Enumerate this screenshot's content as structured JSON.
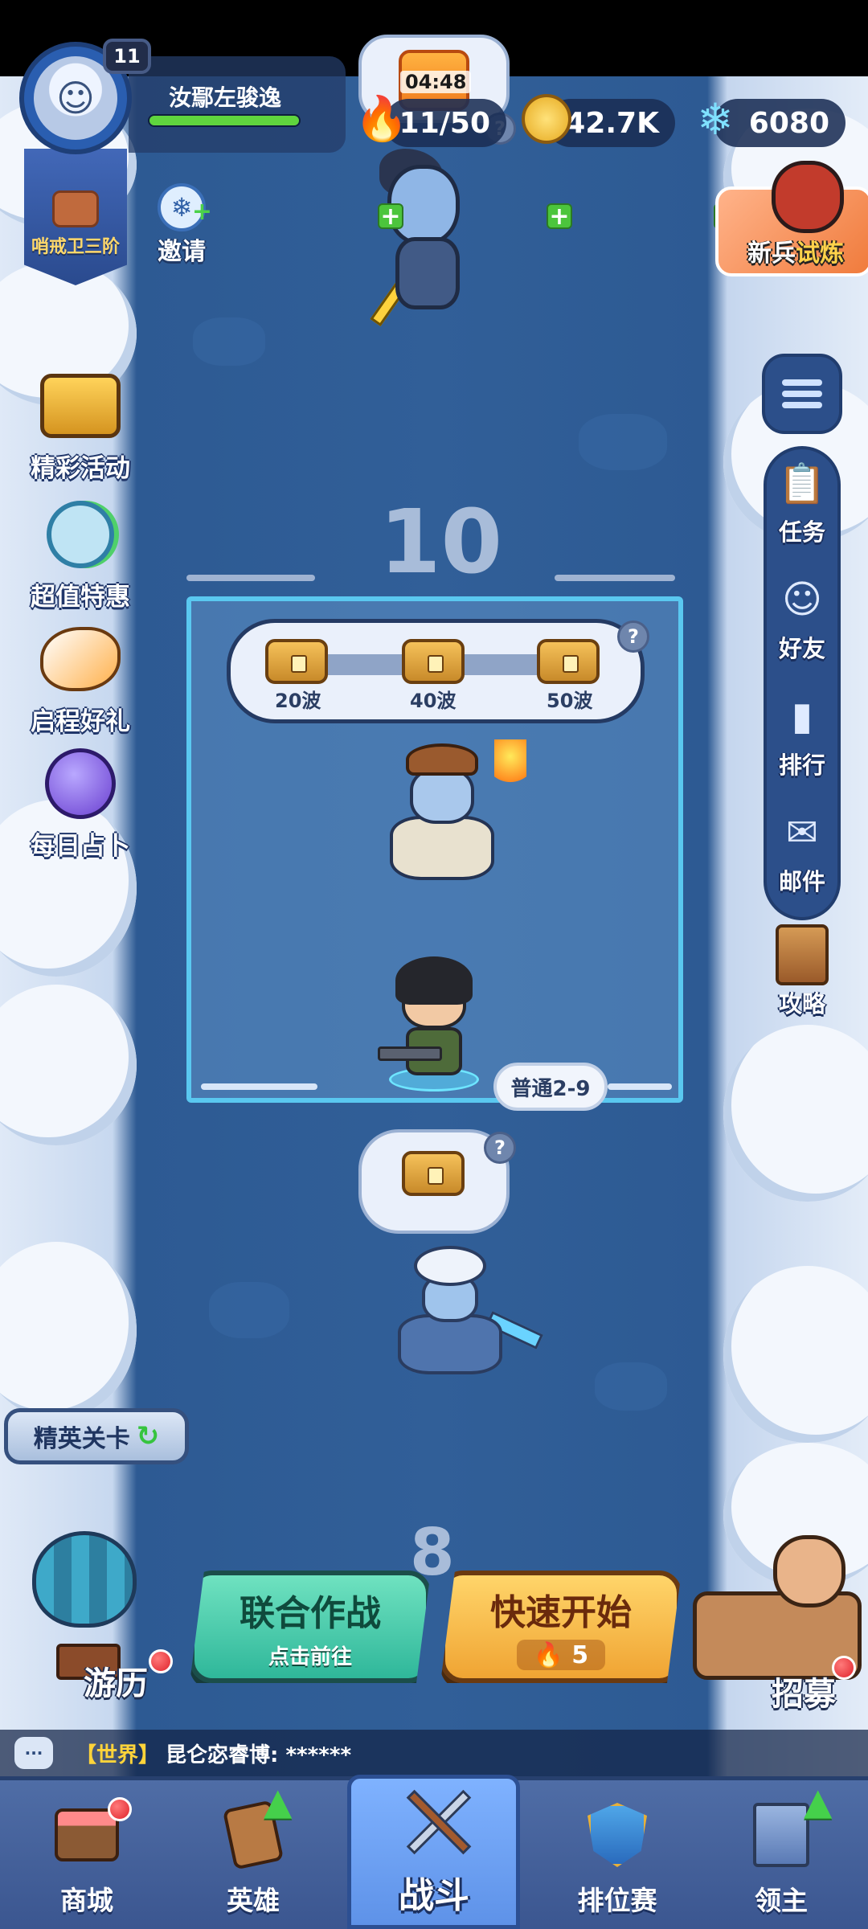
{
  "player": {
    "level": "11",
    "name": "汝鄢左骏逸",
    "rank": "哨戒卫三阶",
    "hp_fraction": 1.0
  },
  "invite": {
    "label": "邀请"
  },
  "timer": {
    "text": "04:48"
  },
  "resources": {
    "stamina": "11/50",
    "gold": "42.7K",
    "crystals": "6080"
  },
  "trial": {
    "label_prefix": "新兵",
    "label_highlight": "试炼"
  },
  "left_menu": [
    {
      "label": "精彩活动",
      "icon": "treasure-chest-icon"
    },
    {
      "label": "超值特惠",
      "icon": "clock-refresh-icon"
    },
    {
      "label": "启程好礼",
      "icon": "phoenix-bird-icon"
    },
    {
      "label": "每日占卜",
      "icon": "crystal-ball-icon"
    }
  ],
  "right_menu": [
    {
      "label": "任务",
      "icon": "clipboard-icon"
    },
    {
      "label": "好友",
      "icon": "friends-icon"
    },
    {
      "label": "排行",
      "icon": "podium-icon"
    },
    {
      "label": "邮件",
      "icon": "mail-icon"
    },
    {
      "label": "攻略",
      "icon": "guide-book-icon"
    }
  ],
  "stage": {
    "wave_current": "10",
    "wave_next": "8",
    "difficulty_tag": "普通2-9",
    "rewards": [
      {
        "label": "20波"
      },
      {
        "label": "40波"
      },
      {
        "label": "50波"
      }
    ]
  },
  "elite": {
    "label": "精英关卡"
  },
  "travel": {
    "label": "游历"
  },
  "recruit": {
    "label": "招募"
  },
  "coop": {
    "title": "联合作战",
    "subtitle": "点击前往"
  },
  "quick_start": {
    "title": "快速开始",
    "cost": "5"
  },
  "chat": {
    "channel": "【世界】",
    "message": "昆仑宓睿博: ******"
  },
  "nav": [
    {
      "label": "商城",
      "icon": "shop-icon"
    },
    {
      "label": "英雄",
      "icon": "hero-card-icon"
    },
    {
      "label": "战斗",
      "icon": "crossed-weapons-icon"
    },
    {
      "label": "排位赛",
      "icon": "shield-badge-icon"
    },
    {
      "label": "领主",
      "icon": "castle-banner-icon"
    }
  ],
  "colors": {
    "river": "#315f98",
    "snow": "#e3ecf8",
    "accent_green": "#4cc53c",
    "accent_orange": "#f0a433"
  }
}
